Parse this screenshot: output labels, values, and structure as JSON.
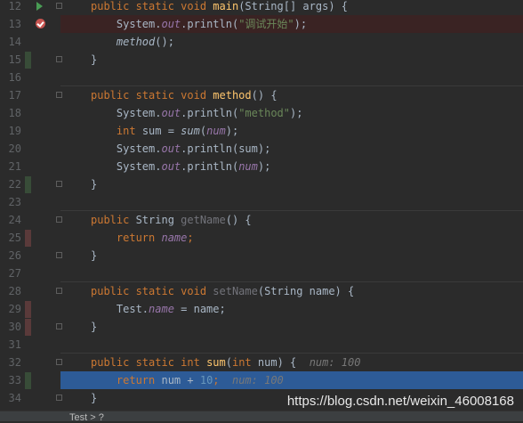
{
  "editor": {
    "lines": [
      {
        "num": "12",
        "gutter": "run",
        "tokens": [
          {
            "t": "public static void ",
            "c": "kw"
          },
          {
            "t": "main",
            "c": "fn"
          },
          {
            "t": "(String[] args) {",
            "c": "pl"
          }
        ]
      },
      {
        "num": "13",
        "gutter": "breakpoint",
        "highlight": "breakpoint",
        "tokens": [
          {
            "t": "    System.",
            "c": "pl"
          },
          {
            "t": "out",
            "c": "it"
          },
          {
            "t": ".println(",
            "c": "pl"
          },
          {
            "t": "\"调试开始\"",
            "c": "str"
          },
          {
            "t": ");",
            "c": "pl"
          }
        ]
      },
      {
        "num": "14",
        "tokens": [
          {
            "t": "    ",
            "c": "pl"
          },
          {
            "t": "method",
            "c": "sit"
          },
          {
            "t": "();",
            "c": "pl"
          }
        ]
      },
      {
        "num": "15",
        "change": "green",
        "tokens": [
          {
            "t": "}",
            "c": "pl"
          }
        ]
      },
      {
        "num": "16",
        "tokens": []
      },
      {
        "num": "17",
        "separator": true,
        "tokens": [
          {
            "t": "public static void ",
            "c": "kw"
          },
          {
            "t": "method",
            "c": "fn"
          },
          {
            "t": "() {",
            "c": "pl"
          }
        ]
      },
      {
        "num": "18",
        "tokens": [
          {
            "t": "    System.",
            "c": "pl"
          },
          {
            "t": "out",
            "c": "it"
          },
          {
            "t": ".println(",
            "c": "pl"
          },
          {
            "t": "\"method\"",
            "c": "str"
          },
          {
            "t": ");",
            "c": "pl"
          }
        ]
      },
      {
        "num": "19",
        "tokens": [
          {
            "t": "    ",
            "c": "pl"
          },
          {
            "t": "int ",
            "c": "kw"
          },
          {
            "t": "sum = ",
            "c": "pl"
          },
          {
            "t": "sum",
            "c": "sit"
          },
          {
            "t": "(",
            "c": "pl"
          },
          {
            "t": "num",
            "c": "it"
          },
          {
            "t": ");",
            "c": "pl"
          }
        ]
      },
      {
        "num": "20",
        "tokens": [
          {
            "t": "    System.",
            "c": "pl"
          },
          {
            "t": "out",
            "c": "it"
          },
          {
            "t": ".println(sum);",
            "c": "pl"
          }
        ]
      },
      {
        "num": "21",
        "tokens": [
          {
            "t": "    System.",
            "c": "pl"
          },
          {
            "t": "out",
            "c": "it"
          },
          {
            "t": ".println(",
            "c": "pl"
          },
          {
            "t": "num",
            "c": "it"
          },
          {
            "t": ");",
            "c": "pl"
          }
        ]
      },
      {
        "num": "22",
        "change": "green",
        "tokens": [
          {
            "t": "}",
            "c": "pl"
          }
        ]
      },
      {
        "num": "23",
        "tokens": []
      },
      {
        "num": "24",
        "separator": true,
        "tokens": [
          {
            "t": "public ",
            "c": "kw"
          },
          {
            "t": "String ",
            "c": "pl"
          },
          {
            "t": "getName",
            "c": "dim"
          },
          {
            "t": "() {",
            "c": "pl"
          }
        ]
      },
      {
        "num": "25",
        "change": "red",
        "tokens": [
          {
            "t": "    ",
            "c": "pl"
          },
          {
            "t": "return ",
            "c": "kw"
          },
          {
            "t": "name",
            "c": "it"
          },
          {
            "t": ";",
            "c": "kw"
          }
        ]
      },
      {
        "num": "26",
        "tokens": [
          {
            "t": "}",
            "c": "pl"
          }
        ]
      },
      {
        "num": "27",
        "tokens": []
      },
      {
        "num": "28",
        "separator": true,
        "tokens": [
          {
            "t": "public static void ",
            "c": "kw"
          },
          {
            "t": "setName",
            "c": "dim"
          },
          {
            "t": "(String name) {",
            "c": "pl"
          }
        ]
      },
      {
        "num": "29",
        "change": "red",
        "tokens": [
          {
            "t": "    Test.",
            "c": "pl"
          },
          {
            "t": "name",
            "c": "it"
          },
          {
            "t": " = name;",
            "c": "pl"
          }
        ]
      },
      {
        "num": "30",
        "change": "red",
        "tokens": [
          {
            "t": "}",
            "c": "pl"
          }
        ]
      },
      {
        "num": "31",
        "tokens": []
      },
      {
        "num": "32",
        "separator": true,
        "tokens": [
          {
            "t": "public static ",
            "c": "kw"
          },
          {
            "t": "int ",
            "c": "kw"
          },
          {
            "t": "sum",
            "c": "fn"
          },
          {
            "t": "(",
            "c": "pl"
          },
          {
            "t": "int ",
            "c": "kw"
          },
          {
            "t": "num) {  ",
            "c": "pl"
          },
          {
            "t": "num: 100",
            "c": "hint"
          }
        ]
      },
      {
        "num": "33",
        "change": "green",
        "highlight": "current",
        "tokens": [
          {
            "t": "    ",
            "c": "pl"
          },
          {
            "t": "return ",
            "c": "kw"
          },
          {
            "t": "num + ",
            "c": "pl"
          },
          {
            "t": "10",
            "c": "num"
          },
          {
            "t": ";  ",
            "c": "kw"
          },
          {
            "t": "num: 100",
            "c": "hint"
          }
        ]
      },
      {
        "num": "34",
        "tokens": [
          {
            "t": "}",
            "c": "pl"
          }
        ]
      }
    ]
  },
  "watermark": "https://blog.csdn.net/weixin_46008168",
  "bottom": {
    "hint": "Test  >  ?"
  },
  "colors": {
    "background": "#2b2b2b",
    "keyword": "#cc7832",
    "method": "#ffc66d",
    "field": "#9876aa",
    "string": "#6a8759",
    "number": "#6897bb",
    "execution_line": "#2d5b97",
    "breakpoint": "#c75450"
  }
}
